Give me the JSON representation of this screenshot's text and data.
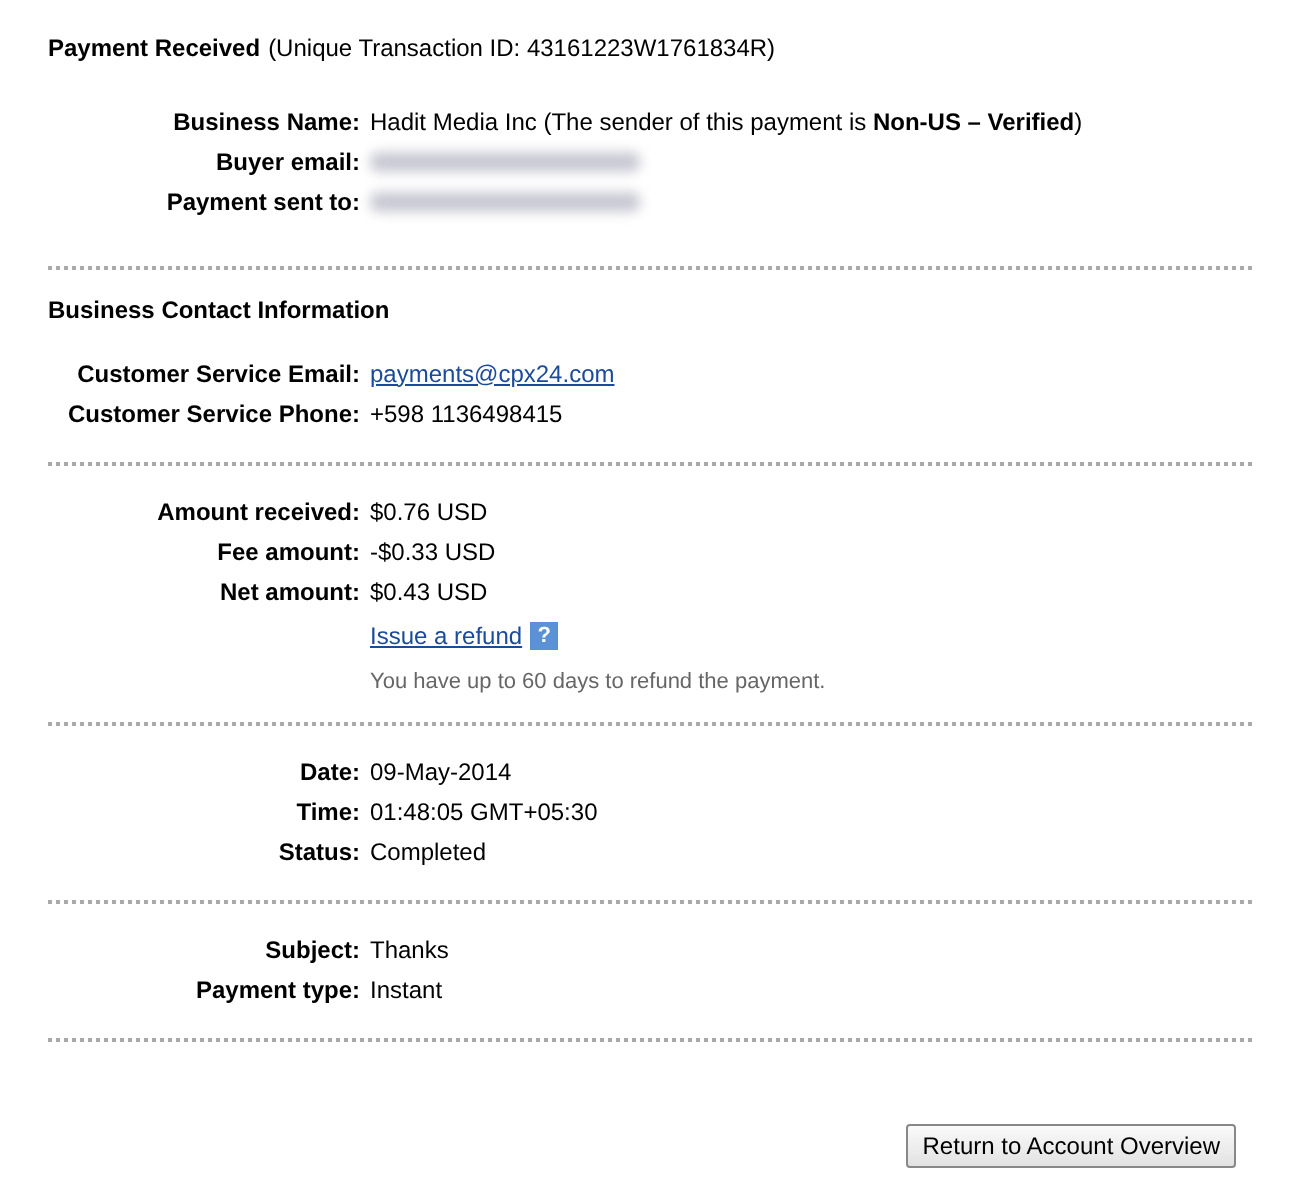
{
  "header": {
    "title": "Payment Received",
    "subtitle": "(Unique Transaction ID: 43161223W1761834R)"
  },
  "sections": [
    {
      "rows": [
        {
          "label": "Business Name:",
          "kind": "rich",
          "value": "Hadit Media Inc (The sender of this payment is **Non-US – Verified**)"
        },
        {
          "label": "Buyer email:",
          "kind": "blurred"
        },
        {
          "label": "Payment sent to:",
          "kind": "blurred"
        }
      ]
    },
    {
      "heading": "Business Contact Information",
      "rows": [
        {
          "label": "Customer Service Email:",
          "kind": "link",
          "value": "payments@cpx24.com"
        },
        {
          "label": "Customer Service Phone:",
          "kind": "text",
          "value": "+598 1136498415"
        }
      ]
    },
    {
      "rows": [
        {
          "label": "Amount received:",
          "kind": "text",
          "value": "$0.76 USD"
        },
        {
          "label": "Fee amount:",
          "kind": "text",
          "value": "-$0.33 USD"
        },
        {
          "label": "Net amount:",
          "kind": "text",
          "value": "$0.43 USD"
        }
      ],
      "refund": {
        "link": "Issue a refund",
        "help": "?",
        "note": "You have up to 60 days to refund the payment."
      }
    },
    {
      "rows": [
        {
          "label": "Date:",
          "kind": "text",
          "value": "09-May-2014"
        },
        {
          "label": "Time:",
          "kind": "text",
          "value": "01:48:05 GMT+05:30"
        },
        {
          "label": "Status:",
          "kind": "text",
          "value": "Completed"
        }
      ]
    },
    {
      "rows": [
        {
          "label": "Subject:",
          "kind": "text",
          "value": "Thanks"
        },
        {
          "label": "Payment type:",
          "kind": "text",
          "value": "Instant"
        }
      ]
    }
  ],
  "button": "Return to Account Overview"
}
